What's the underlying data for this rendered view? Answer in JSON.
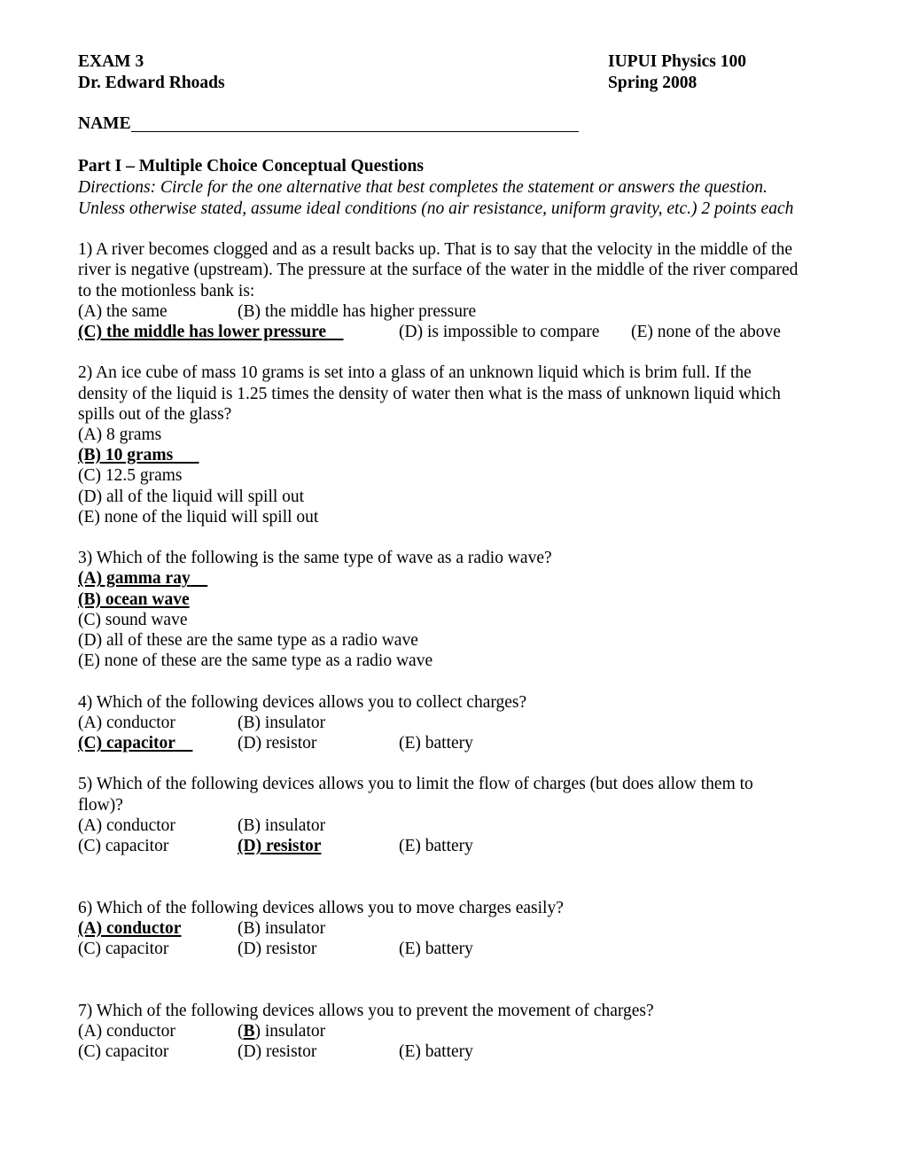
{
  "header": {
    "exam_title": "EXAM 3",
    "course": "IUPUI Physics 100",
    "instructor": "Dr. Edward Rhoads",
    "term": "Spring 2008",
    "name_label": "NAME"
  },
  "part": {
    "heading": "Part I – Multiple Choice Conceptual Questions",
    "directions": "Directions: Circle for the one alternative that best completes the statement or answers the question.  Unless otherwise stated, assume ideal conditions (no air resistance, uniform gravity, etc.) 2 points each"
  },
  "questions": [
    {
      "number": "1)",
      "stem": "1) A river becomes clogged and as a result backs up.  That is to say that the velocity in the middle of the river is negative (upstream).  The pressure at the surface of the water in the middle of the river compared to the motionless bank is:",
      "options": {
        "a": "(A) the same",
        "b": "(B) the middle has higher pressure",
        "c": "(C) the middle has lower pressure",
        "d": "(D) is impossible to compare",
        "e": "(E) none of the above"
      },
      "marked": [
        "c"
      ]
    },
    {
      "number": "2)",
      "stem": "2) An ice cube of mass 10 grams is set into a glass of an unknown liquid which is brim full.  If the density of the liquid is 1.25 times the density of water then what is the mass of unknown liquid which spills out of the glass?",
      "options": {
        "a": "(A) 8 grams",
        "b": "(B) 10 grams",
        "c": "(C) 12.5 grams",
        "d": "(D) all of the liquid will spill out",
        "e": "(E) none of the liquid will spill out"
      },
      "marked": [
        "b"
      ]
    },
    {
      "number": "3)",
      "stem": "3) Which of the following is the same type of wave as a radio wave?",
      "options": {
        "a": "(A) gamma ray",
        "b": "(B) ocean wave",
        "c": "(C) sound wave",
        "d": "(D) all of these are the same type as a radio wave",
        "e": "(E) none of these are the same type as a radio wave"
      },
      "marked": [
        "a",
        "b"
      ]
    },
    {
      "number": "4)",
      "stem": "4) Which of the following devices allows you to collect charges?",
      "options": {
        "a": "(A) conductor",
        "b": "(B) insulator",
        "c": "(C) capacitor",
        "d": "(D) resistor",
        "e": "(E) battery"
      },
      "marked": [
        "c"
      ]
    },
    {
      "number": "5)",
      "stem": "5) Which of the following devices allows you to limit the flow of charges (but does allow them to flow)?",
      "options": {
        "a": "(A) conductor",
        "b": "(B) insulator",
        "c": "(C) capacitor",
        "d": "(D) resistor",
        "e": "(E) battery"
      },
      "marked": [
        "d"
      ]
    },
    {
      "number": "6)",
      "stem": "6) Which of the following devices allows you to move charges easily?",
      "options": {
        "a": "(A) conductor",
        "b": "(B) insulator",
        "c": "(C) capacitor",
        "d": "(D) resistor",
        "e": "(E) battery"
      },
      "marked": [
        "a"
      ]
    },
    {
      "number": "7)",
      "stem": "7) Which of the following devices allows you to prevent the movement of charges?",
      "options": {
        "a": "(A) conductor",
        "b_letter": "(B",
        "b_marked_letter": "B",
        "b_rest": ") insulator",
        "b": "(B) insulator",
        "c": "(C) capacitor",
        "d": "(D) resistor",
        "e": "(E) battery"
      },
      "marked": [
        "b-letter-only"
      ]
    }
  ]
}
